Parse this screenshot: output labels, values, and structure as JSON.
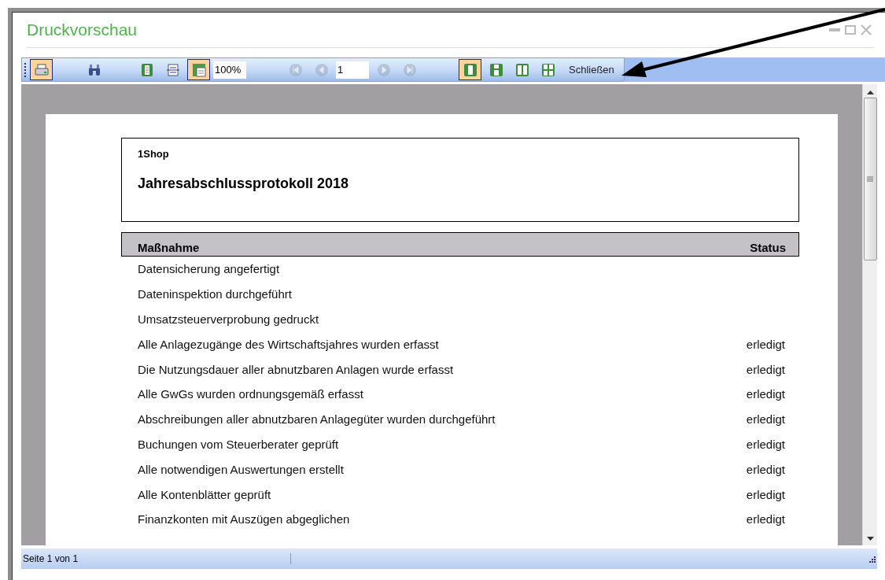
{
  "window": {
    "title": "Druckvorschau"
  },
  "toolbar": {
    "tools": [
      {
        "kind": "print",
        "selected": true
      },
      {
        "kind": "find",
        "selected": false
      },
      {
        "kind": "page",
        "selected": false
      },
      {
        "kind": "width",
        "selected": false
      },
      {
        "kind": "zoom",
        "selected": true
      }
    ],
    "zoom": "100%",
    "nav": [
      {
        "kind": "first",
        "disabled": true
      },
      {
        "kind": "prev",
        "disabled": true
      }
    ],
    "page_number": "1",
    "nav_after": [
      {
        "kind": "next",
        "disabled": true
      },
      {
        "kind": "last",
        "disabled": true
      }
    ],
    "views": [
      {
        "kind": "one",
        "selected": true
      },
      {
        "kind": "two",
        "selected": false
      },
      {
        "kind": "three",
        "selected": false
      },
      {
        "kind": "four",
        "selected": false
      }
    ],
    "close_label": "Schließen"
  },
  "report": {
    "company": "1Shop",
    "title": "Jahresabschlussprotokoll 2018",
    "columns": [
      "Maßnahme",
      "Status"
    ],
    "rows": [
      {
        "task": "Datensicherung angefertigt"
      },
      {
        "task": "Dateninspektion durchgeführt"
      },
      {
        "task": "Umsatzsteuerverprobung gedruckt"
      },
      {
        "task": "Alle Anlagezugänge des Wirtschaftsjahres wurden erfasst",
        "status": "erledigt"
      },
      {
        "task": "Die Nutzungsdauer aller abnutzbaren Anlagen wurde erfasst",
        "status": "erledigt"
      },
      {
        "task": "Alle GwGs wurden ordnungsgemäß erfasst",
        "status": "erledigt"
      },
      {
        "task": "Abschreibungen aller abnutzbaren Anlagegüter wurden durchgeführt",
        "status": "erledigt"
      },
      {
        "task": "Buchungen vom Steuerberater geprüft",
        "status": "erledigt"
      },
      {
        "task": "Alle notwendigen Auswertungen erstellt",
        "status": "erledigt"
      },
      {
        "task": "Alle Kontenblätter geprüft",
        "status": "erledigt"
      },
      {
        "task": "Finanzkonten mit Auszügen abgeglichen",
        "status": "erledigt"
      }
    ]
  },
  "status_bar": {
    "text": "Seite 1 von 1"
  }
}
